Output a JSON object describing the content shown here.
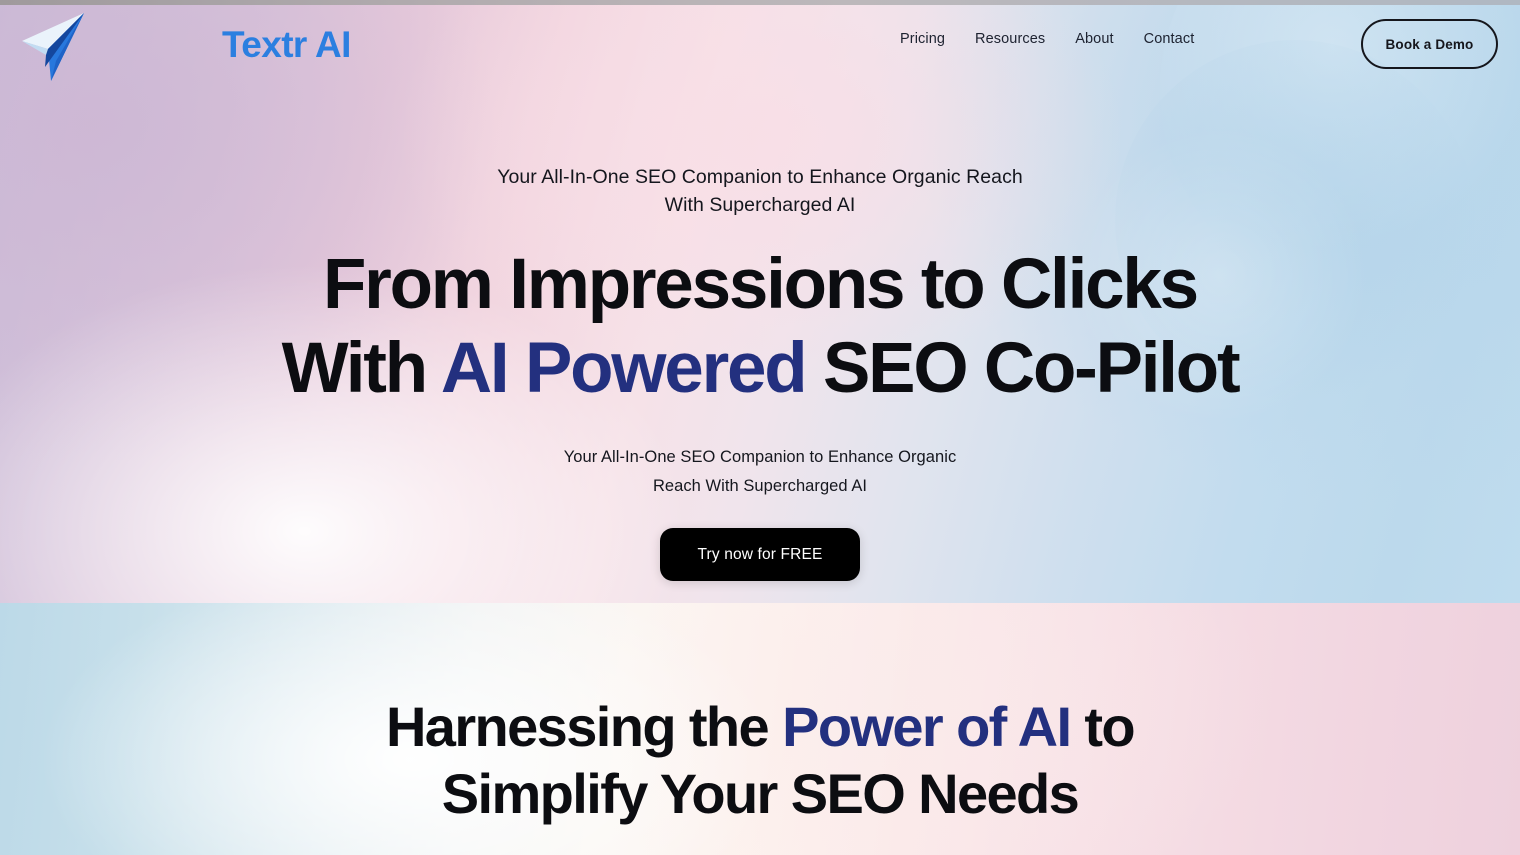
{
  "brand": {
    "name": "Textr AI",
    "logo_icon": "paper-plane-icon",
    "name_color": "#2b7fe0"
  },
  "nav": {
    "links": [
      {
        "label": "Pricing"
      },
      {
        "label": "Resources"
      },
      {
        "label": "About"
      },
      {
        "label": "Contact"
      }
    ],
    "cta": {
      "label": "Book a Demo"
    }
  },
  "hero": {
    "eyebrow_line1": "Your All-In-One SEO Companion to Enhance Organic Reach",
    "eyebrow_line2": "With Supercharged AI",
    "headline_line1": "From Impressions to Clicks",
    "headline_line2_pre": "With ",
    "headline_line2_accent": "AI Powered",
    "headline_line2_post": " SEO Co-Pilot",
    "subcopy_line1": "Your All-In-One SEO Companion to Enhance Organic",
    "subcopy_line2": "Reach With Supercharged AI",
    "cta_label": "Try now for FREE",
    "accent_color": "#23307f",
    "cta_bg": "#000000",
    "cta_text_color": "#ffffff"
  },
  "section2": {
    "heading_pre": "Harnessing the ",
    "heading_accent": "Power of AI",
    "heading_post": " to",
    "heading_line2": "Simplify Your SEO Needs",
    "accent_color": "#23307f"
  }
}
